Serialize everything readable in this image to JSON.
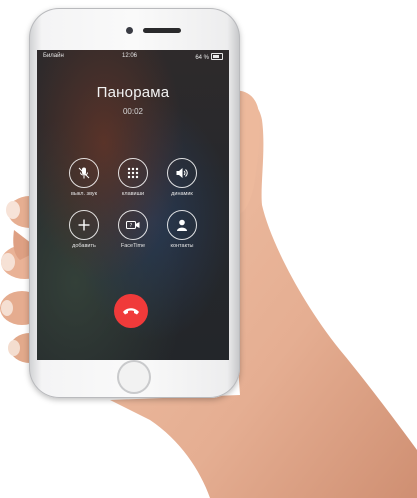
{
  "status_bar": {
    "carrier": "Билайн",
    "time": "12:06",
    "battery": "64 %"
  },
  "call": {
    "caller_name": "Панорама",
    "duration": "00:02"
  },
  "buttons": [
    {
      "label": "выкл. звук",
      "icon": "mute-icon"
    },
    {
      "label": "клавиши",
      "icon": "keypad-icon"
    },
    {
      "label": "динамик",
      "icon": "speaker-icon"
    },
    {
      "label": "добавить",
      "icon": "add-call-icon"
    },
    {
      "label": "FaceTime",
      "icon": "facetime-icon"
    },
    {
      "label": "контакты",
      "icon": "contacts-icon"
    }
  ],
  "colors": {
    "end_call": "#f03a3a",
    "skin": "#e9b497",
    "phone_body": "#f4f4f5"
  }
}
